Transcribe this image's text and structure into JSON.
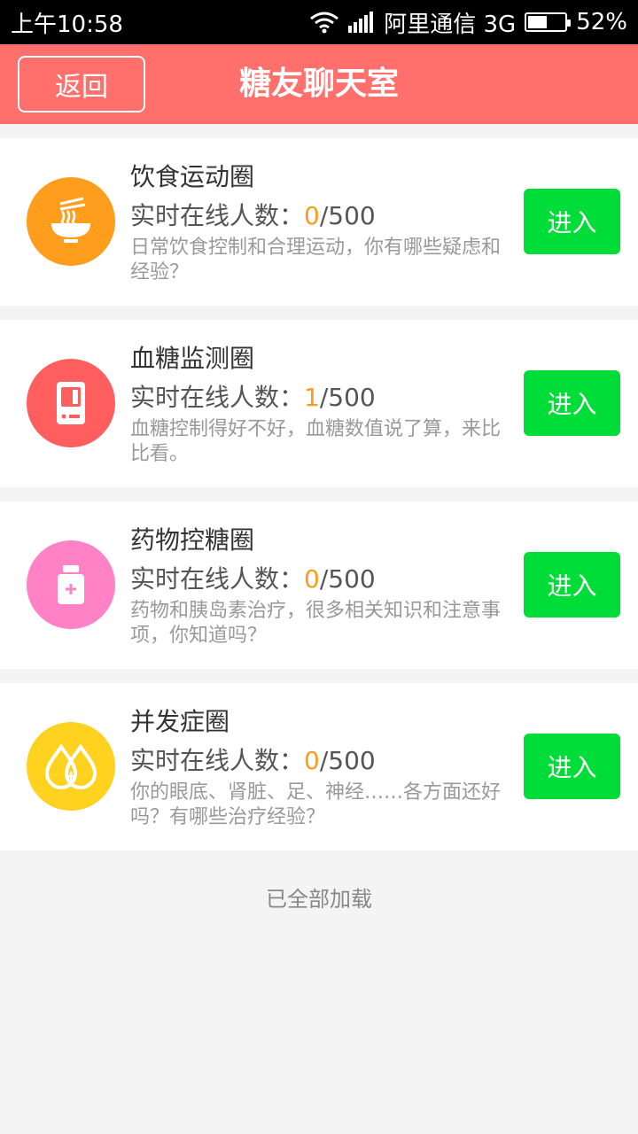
{
  "status_bar": {
    "time": "上午10:58",
    "carrier": "阿里通信 3G",
    "battery": "52%",
    "battery_level": 0.52
  },
  "navbar": {
    "back_label": "返回",
    "title": "糖友聊天室"
  },
  "online_label": "实时在线人数：",
  "enter_label": "进入",
  "circles": [
    {
      "title": "饮食运动圈",
      "online_current": "0",
      "online_max": "/500",
      "description": "日常饮食控制和合理运动，你有哪些疑虑和经验？",
      "icon": "noodle-bowl-icon",
      "color": "#ff9d1d"
    },
    {
      "title": "血糖监测圈",
      "online_current": "1",
      "online_max": "/500",
      "description": "血糖控制得好不好，血糖数值说了算，来比比看。",
      "icon": "glucose-meter-icon",
      "color": "#ff5e5e"
    },
    {
      "title": "药物控糖圈",
      "online_current": "0",
      "online_max": "/500",
      "description": "药物和胰岛素治疗，很多相关知识和注意事项，你知道吗？",
      "icon": "medicine-bottle-icon",
      "color": "#ff82c6"
    },
    {
      "title": "并发症圈",
      "online_current": "0",
      "online_max": "/500",
      "description": "你的眼底、肾脏、足、神经……各方面还好吗？有哪些治疗经验？",
      "icon": "blood-drops-icon",
      "color": "#ffd21f"
    }
  ],
  "footer_text": "已全部加载"
}
